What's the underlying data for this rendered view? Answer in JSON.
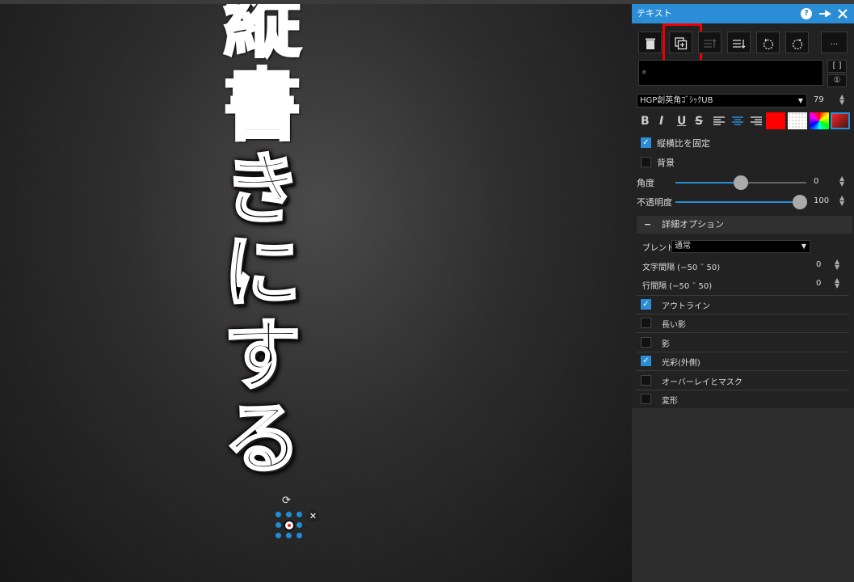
{
  "canvas": {
    "vertical_chars": [
      "縦",
      "書",
      "き",
      "に",
      "す",
      "る"
    ],
    "close_symbol": "✕",
    "rotate_symbol": "⟳"
  },
  "panel": {
    "title": "テキスト",
    "help_label": "?",
    "pin_icon": "pin-icon",
    "close_icon": "close-icon",
    "toolbar": {
      "more_label": "..."
    },
    "text_value": "。",
    "bracket_label": "[ ]",
    "info_label": "①",
    "font": {
      "family_value": "HGP創英角ｺﾞｼｯｸUB",
      "size_value": "79"
    },
    "format": {
      "bold": "B",
      "italic": "I",
      "underline": "U",
      "strike": "S"
    },
    "colors": {
      "fill": "#ff0000",
      "accent": "#2b8dd6"
    },
    "lock_ratio_label": "縦横比を固定",
    "background_label": "背景",
    "angle": {
      "label": "角度",
      "value": "0"
    },
    "opacity": {
      "label": "不透明度",
      "value": "100"
    },
    "advanced": {
      "toggle": "−",
      "title": "詳細オプション",
      "blend_label": "ブレンド",
      "blend_value": "通常",
      "char_spacing_label": "文字間隔 (−50 ˜ 50)",
      "char_spacing_value": "0",
      "line_spacing_label": "行間隔 (−50 ˜ 50)",
      "line_spacing_value": "0"
    },
    "effects": [
      {
        "label": "アウトライン",
        "checked": true
      },
      {
        "label": "長い影",
        "checked": false
      },
      {
        "label": "影",
        "checked": false
      },
      {
        "label": "光彩(外側)",
        "checked": true
      },
      {
        "label": "オーバーレイとマスク",
        "checked": false
      },
      {
        "label": "変形",
        "checked": false
      }
    ],
    "check_mark": "✓"
  }
}
